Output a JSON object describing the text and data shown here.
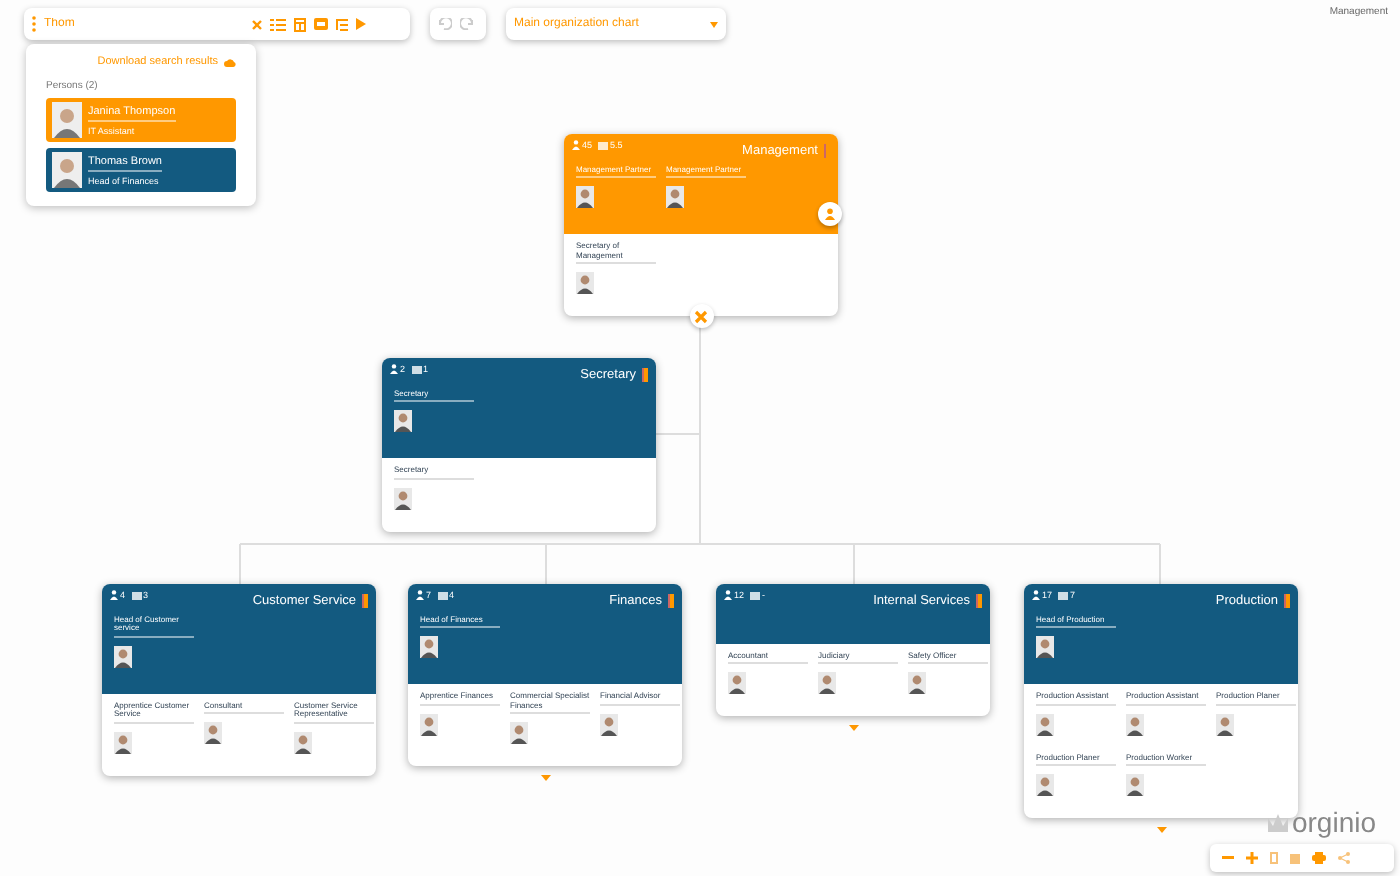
{
  "toolbar": {
    "search": {
      "value": "Thom"
    },
    "chart_select": {
      "value": "Main organization chart"
    }
  },
  "breadcrumb": "Management",
  "search_results": {
    "download": "Download search results",
    "heading": "Persons (2)",
    "persons": [
      {
        "name": "Janina Thompson",
        "role": "IT Assistant",
        "selected": true
      },
      {
        "name": "Thomas Brown",
        "role": "Head of Finances",
        "selected": false
      }
    ]
  },
  "units": [
    {
      "title": "Management",
      "people": "45",
      "positions": "5.5",
      "selected": true,
      "expanded": true,
      "heads": [
        "Management Partner",
        "Management Partner"
      ],
      "staff": [
        "Secretary of Management"
      ]
    },
    {
      "title": "Secretary",
      "people": "2",
      "positions": "1",
      "selected": false,
      "heads": [
        "Secretary"
      ],
      "staff": [
        "Secretary"
      ]
    },
    {
      "title": "Customer Service",
      "people": "4",
      "positions": "3",
      "selected": false,
      "heads": [
        "Head of Customer service"
      ],
      "staff": [
        "Apprentice Customer Service",
        "Consultant",
        "Customer Service Representative"
      ]
    },
    {
      "title": "Finances",
      "people": "7",
      "positions": "4",
      "selected": false,
      "expanded": false,
      "heads": [
        "Head of Finances"
      ],
      "staff": [
        "Apprentice Finances",
        "Commercial Specialist Finances",
        "Financial Advisor"
      ]
    },
    {
      "title": "Internal Services",
      "people": "12",
      "positions": "-",
      "selected": false,
      "expanded": false,
      "staff": [
        "Accountant",
        "Judiciary",
        "Safety Officer"
      ]
    },
    {
      "title": "Production",
      "people": "17",
      "positions": "7",
      "selected": false,
      "expanded": false,
      "heads": [
        "Head of Production"
      ],
      "staff": [
        "Production Assistant",
        "Production Assistant",
        "Production Planer",
        "Production Planer",
        "Production Worker"
      ]
    }
  ],
  "logo": "orginio"
}
